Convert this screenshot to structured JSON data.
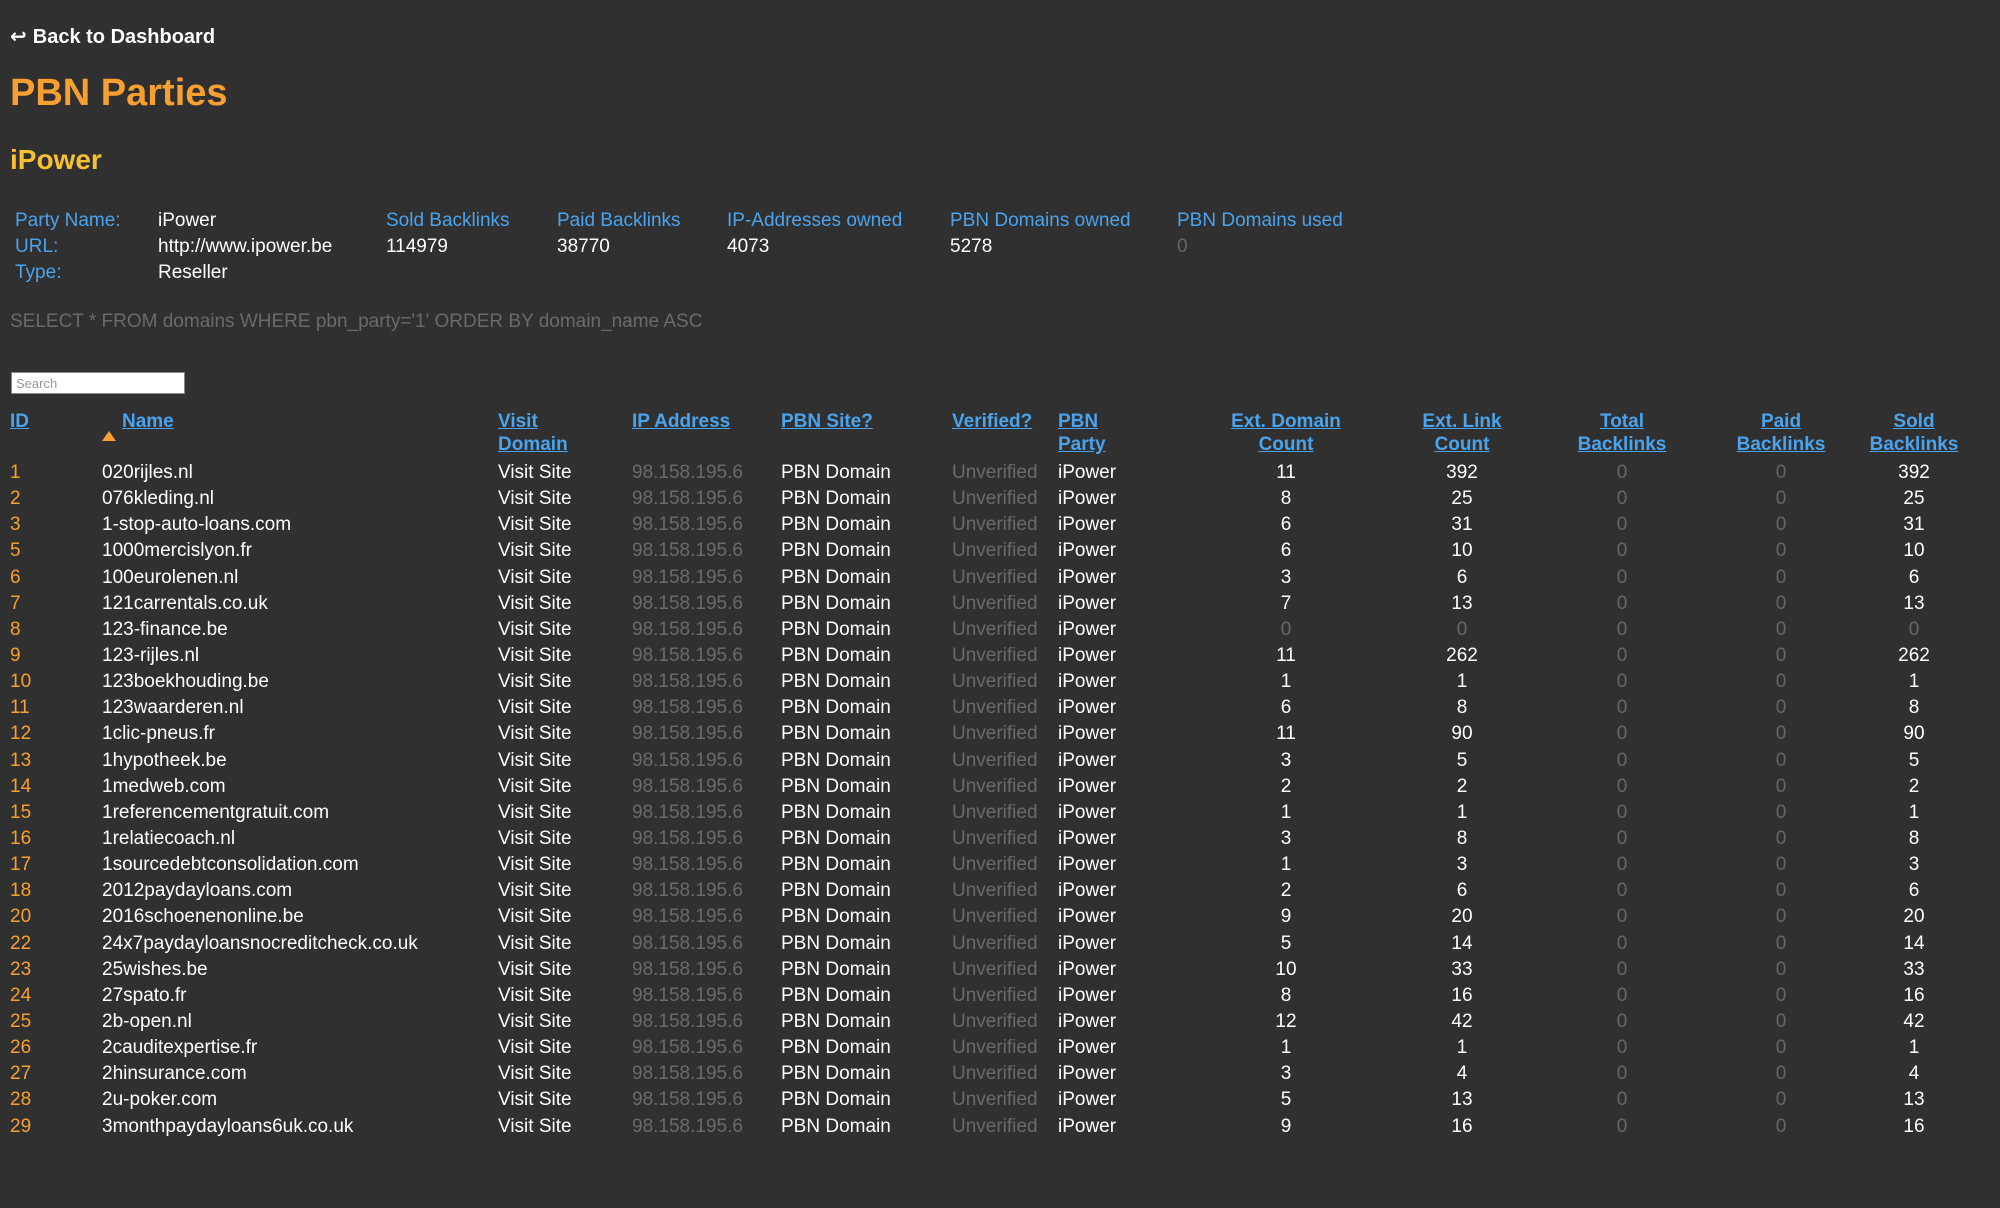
{
  "nav": {
    "back_arrow": "↩",
    "back_label": "Back to Dashboard"
  },
  "page_title": "PBN Parties",
  "party_title": "iPower",
  "party": {
    "name_label": "Party Name:",
    "name": "iPower",
    "url_label": "URL:",
    "url": "http://www.ipower.be",
    "type_label": "Type:",
    "type": "Reseller"
  },
  "stats": [
    {
      "label": "Sold Backlinks",
      "value": "114979"
    },
    {
      "label": "Paid Backlinks",
      "value": "38770"
    },
    {
      "label": "IP-Addresses owned",
      "value": "4073"
    },
    {
      "label": "PBN Domains owned",
      "value": "5278"
    },
    {
      "label": "PBN Domains used",
      "value": "0"
    }
  ],
  "sql": "SELECT * FROM domains WHERE pbn_party='1' ORDER BY domain_name ASC",
  "search": {
    "placeholder": "Search"
  },
  "colors": {
    "accent": "#f7a031",
    "subtitle": "#f7c032",
    "link": "#4aa3ec",
    "muted": "#6a6a6a",
    "background": "#303030"
  },
  "table": {
    "headers": {
      "id": "ID",
      "name": "Name",
      "visit_domain": [
        "Visit",
        "Domain"
      ],
      "ip_address": "IP Address",
      "pbn_site": "PBN Site?",
      "verified": "Verified?",
      "pbn_party": [
        "PBN",
        "Party"
      ],
      "ext_domain_count": [
        "Ext. Domain",
        "Count"
      ],
      "ext_link_count": [
        "Ext. Link",
        "Count"
      ],
      "total_backlinks": [
        "Total",
        "Backlinks"
      ],
      "paid_backlinks": [
        "Paid",
        "Backlinks"
      ],
      "sold_backlinks": [
        "Sold",
        "Backlinks"
      ]
    },
    "sort_icon": "sort-ascending-icon",
    "rows": [
      {
        "id": "1",
        "name": "020rijles.nl",
        "visit": "Visit Site",
        "ip": "98.158.195.6",
        "site": "PBN Domain",
        "verified": "Unverified",
        "party": "iPower",
        "ext_domain": "11",
        "ext_link": "392",
        "total": "0",
        "paid": "0",
        "sold": "392"
      },
      {
        "id": "2",
        "name": "076kleding.nl",
        "visit": "Visit Site",
        "ip": "98.158.195.6",
        "site": "PBN Domain",
        "verified": "Unverified",
        "party": "iPower",
        "ext_domain": "8",
        "ext_link": "25",
        "total": "0",
        "paid": "0",
        "sold": "25"
      },
      {
        "id": "3",
        "name": "1-stop-auto-loans.com",
        "visit": "Visit Site",
        "ip": "98.158.195.6",
        "site": "PBN Domain",
        "verified": "Unverified",
        "party": "iPower",
        "ext_domain": "6",
        "ext_link": "31",
        "total": "0",
        "paid": "0",
        "sold": "31"
      },
      {
        "id": "5",
        "name": "1000mercislyon.fr",
        "visit": "Visit Site",
        "ip": "98.158.195.6",
        "site": "PBN Domain",
        "verified": "Unverified",
        "party": "iPower",
        "ext_domain": "6",
        "ext_link": "10",
        "total": "0",
        "paid": "0",
        "sold": "10"
      },
      {
        "id": "6",
        "name": "100eurolenen.nl",
        "visit": "Visit Site",
        "ip": "98.158.195.6",
        "site": "PBN Domain",
        "verified": "Unverified",
        "party": "iPower",
        "ext_domain": "3",
        "ext_link": "6",
        "total": "0",
        "paid": "0",
        "sold": "6"
      },
      {
        "id": "7",
        "name": "121carrentals.co.uk",
        "visit": "Visit Site",
        "ip": "98.158.195.6",
        "site": "PBN Domain",
        "verified": "Unverified",
        "party": "iPower",
        "ext_domain": "7",
        "ext_link": "13",
        "total": "0",
        "paid": "0",
        "sold": "13"
      },
      {
        "id": "8",
        "name": "123-finance.be",
        "visit": "Visit Site",
        "ip": "98.158.195.6",
        "site": "PBN Domain",
        "verified": "Unverified",
        "party": "iPower",
        "ext_domain": "0",
        "ext_link": "0",
        "total": "0",
        "paid": "0",
        "sold": "0"
      },
      {
        "id": "9",
        "name": "123-rijles.nl",
        "visit": "Visit Site",
        "ip": "98.158.195.6",
        "site": "PBN Domain",
        "verified": "Unverified",
        "party": "iPower",
        "ext_domain": "11",
        "ext_link": "262",
        "total": "0",
        "paid": "0",
        "sold": "262"
      },
      {
        "id": "10",
        "name": "123boekhouding.be",
        "visit": "Visit Site",
        "ip": "98.158.195.6",
        "site": "PBN Domain",
        "verified": "Unverified",
        "party": "iPower",
        "ext_domain": "1",
        "ext_link": "1",
        "total": "0",
        "paid": "0",
        "sold": "1"
      },
      {
        "id": "11",
        "name": "123waarderen.nl",
        "visit": "Visit Site",
        "ip": "98.158.195.6",
        "site": "PBN Domain",
        "verified": "Unverified",
        "party": "iPower",
        "ext_domain": "6",
        "ext_link": "8",
        "total": "0",
        "paid": "0",
        "sold": "8"
      },
      {
        "id": "12",
        "name": "1clic-pneus.fr",
        "visit": "Visit Site",
        "ip": "98.158.195.6",
        "site": "PBN Domain",
        "verified": "Unverified",
        "party": "iPower",
        "ext_domain": "11",
        "ext_link": "90",
        "total": "0",
        "paid": "0",
        "sold": "90"
      },
      {
        "id": "13",
        "name": "1hypotheek.be",
        "visit": "Visit Site",
        "ip": "98.158.195.6",
        "site": "PBN Domain",
        "verified": "Unverified",
        "party": "iPower",
        "ext_domain": "3",
        "ext_link": "5",
        "total": "0",
        "paid": "0",
        "sold": "5"
      },
      {
        "id": "14",
        "name": "1medweb.com",
        "visit": "Visit Site",
        "ip": "98.158.195.6",
        "site": "PBN Domain",
        "verified": "Unverified",
        "party": "iPower",
        "ext_domain": "2",
        "ext_link": "2",
        "total": "0",
        "paid": "0",
        "sold": "2"
      },
      {
        "id": "15",
        "name": "1referencementgratuit.com",
        "visit": "Visit Site",
        "ip": "98.158.195.6",
        "site": "PBN Domain",
        "verified": "Unverified",
        "party": "iPower",
        "ext_domain": "1",
        "ext_link": "1",
        "total": "0",
        "paid": "0",
        "sold": "1"
      },
      {
        "id": "16",
        "name": "1relatiecoach.nl",
        "visit": "Visit Site",
        "ip": "98.158.195.6",
        "site": "PBN Domain",
        "verified": "Unverified",
        "party": "iPower",
        "ext_domain": "3",
        "ext_link": "8",
        "total": "0",
        "paid": "0",
        "sold": "8"
      },
      {
        "id": "17",
        "name": "1sourcedebtconsolidation.com",
        "visit": "Visit Site",
        "ip": "98.158.195.6",
        "site": "PBN Domain",
        "verified": "Unverified",
        "party": "iPower",
        "ext_domain": "1",
        "ext_link": "3",
        "total": "0",
        "paid": "0",
        "sold": "3"
      },
      {
        "id": "18",
        "name": "2012paydayloans.com",
        "visit": "Visit Site",
        "ip": "98.158.195.6",
        "site": "PBN Domain",
        "verified": "Unverified",
        "party": "iPower",
        "ext_domain": "2",
        "ext_link": "6",
        "total": "0",
        "paid": "0",
        "sold": "6"
      },
      {
        "id": "20",
        "name": "2016schoenenonline.be",
        "visit": "Visit Site",
        "ip": "98.158.195.6",
        "site": "PBN Domain",
        "verified": "Unverified",
        "party": "iPower",
        "ext_domain": "9",
        "ext_link": "20",
        "total": "0",
        "paid": "0",
        "sold": "20"
      },
      {
        "id": "22",
        "name": "24x7paydayloansnocreditcheck.co.uk",
        "visit": "Visit Site",
        "ip": "98.158.195.6",
        "site": "PBN Domain",
        "verified": "Unverified",
        "party": "iPower",
        "ext_domain": "5",
        "ext_link": "14",
        "total": "0",
        "paid": "0",
        "sold": "14"
      },
      {
        "id": "23",
        "name": "25wishes.be",
        "visit": "Visit Site",
        "ip": "98.158.195.6",
        "site": "PBN Domain",
        "verified": "Unverified",
        "party": "iPower",
        "ext_domain": "10",
        "ext_link": "33",
        "total": "0",
        "paid": "0",
        "sold": "33"
      },
      {
        "id": "24",
        "name": "27spato.fr",
        "visit": "Visit Site",
        "ip": "98.158.195.6",
        "site": "PBN Domain",
        "verified": "Unverified",
        "party": "iPower",
        "ext_domain": "8",
        "ext_link": "16",
        "total": "0",
        "paid": "0",
        "sold": "16"
      },
      {
        "id": "25",
        "name": "2b-open.nl",
        "visit": "Visit Site",
        "ip": "98.158.195.6",
        "site": "PBN Domain",
        "verified": "Unverified",
        "party": "iPower",
        "ext_domain": "12",
        "ext_link": "42",
        "total": "0",
        "paid": "0",
        "sold": "42"
      },
      {
        "id": "26",
        "name": "2cauditexpertise.fr",
        "visit": "Visit Site",
        "ip": "98.158.195.6",
        "site": "PBN Domain",
        "verified": "Unverified",
        "party": "iPower",
        "ext_domain": "1",
        "ext_link": "1",
        "total": "0",
        "paid": "0",
        "sold": "1"
      },
      {
        "id": "27",
        "name": "2hinsurance.com",
        "visit": "Visit Site",
        "ip": "98.158.195.6",
        "site": "PBN Domain",
        "verified": "Unverified",
        "party": "iPower",
        "ext_domain": "3",
        "ext_link": "4",
        "total": "0",
        "paid": "0",
        "sold": "4"
      },
      {
        "id": "28",
        "name": "2u-poker.com",
        "visit": "Visit Site",
        "ip": "98.158.195.6",
        "site": "PBN Domain",
        "verified": "Unverified",
        "party": "iPower",
        "ext_domain": "5",
        "ext_link": "13",
        "total": "0",
        "paid": "0",
        "sold": "13"
      },
      {
        "id": "29",
        "name": "3monthpaydayloans6uk.co.uk",
        "visit": "Visit Site",
        "ip": "98.158.195.6",
        "site": "PBN Domain",
        "verified": "Unverified",
        "party": "iPower",
        "ext_domain": "9",
        "ext_link": "16",
        "total": "0",
        "paid": "0",
        "sold": "16"
      }
    ]
  }
}
